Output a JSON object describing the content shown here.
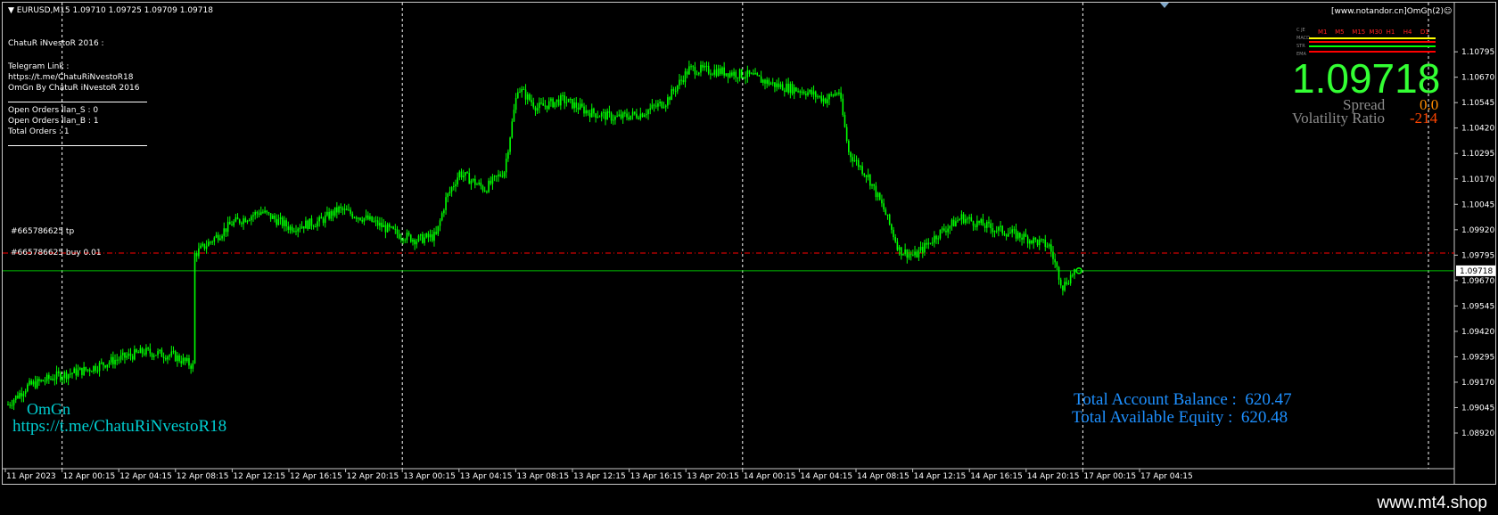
{
  "header": {
    "symbol_line": "EURUSD,M15  1.09710 1.09725 1.09709 1.09718",
    "site_label": "[www.notandor.cn]OmGn",
    "site_suffix": "(2)☺"
  },
  "info_panel": {
    "title": "ChatuR iNvestoR 2016 :",
    "telegram_label": "Telegram Link  :",
    "telegram_url": " https://t.me/ChatuRiNvestoR18",
    "byline": "OmGn By ChatuR iNvestoR 2016",
    "rows": [
      {
        "label": "Open Orders Ilan_S  :",
        "value": "0"
      },
      {
        "label": "Open Orders Ilan_B  :",
        "value": "1"
      },
      {
        "label": "Total Orders         :",
        "value": "1"
      }
    ]
  },
  "price_panel": {
    "big_price": "1.09718",
    "spread_label": "Spread",
    "spread_value": "0.0",
    "vol_label": "Volatility Ratio",
    "vol_value": "-214",
    "tf_labels": [
      "M1",
      "M5",
      "M15",
      "M30",
      "H1",
      "H4",
      "D1"
    ],
    "ind_labels": [
      "C JE",
      "MACD",
      "STR",
      "EMA"
    ]
  },
  "account": {
    "balance_label": "Total Account Balance  :",
    "balance_value": "620.47",
    "equity_label": "Total Available Equity   :",
    "equity_value": "620.48"
  },
  "brand": {
    "name": "OmGn",
    "url": "https://t.me/ChatuRiNvestoR18"
  },
  "footer": {
    "text": "www.mt4.shop"
  },
  "order_lines": {
    "tp_label": "#665786625 tp",
    "buy_label": "#665786625 buy 0.01",
    "tp_price": 1.09805,
    "buy_price": 1.09718
  },
  "colors": {
    "bull": "#00ff00",
    "bear": "#00ff00",
    "tp_line": "#ff0000",
    "buy_line": "#00c000",
    "grid": "#ffffff",
    "big_price": "#33ff33",
    "spread_value": "#ff8c00",
    "vol_value": "#ff4500",
    "account_text": "#1e90ff",
    "brand_text": "#00ced1"
  },
  "chart_data": {
    "type": "candlestick",
    "symbol": "EURUSD",
    "timeframe": "M15",
    "ylim": [
      1.0892,
      1.10835
    ],
    "y_ticks": [
      1.10795,
      1.1067,
      1.10545,
      1.1042,
      1.10295,
      1.1017,
      1.10045,
      1.0992,
      1.09795,
      1.0967,
      1.09545,
      1.0942,
      1.09295,
      1.0917,
      1.09045,
      1.0892
    ],
    "current_price": 1.09718,
    "x_ticks": [
      "11 Apr 2023",
      "12 Apr 00:15",
      "12 Apr 04:15",
      "12 Apr 08:15",
      "12 Apr 12:15",
      "12 Apr 16:15",
      "12 Apr 20:15",
      "13 Apr 00:15",
      "13 Apr 04:15",
      "13 Apr 08:15",
      "13 Apr 12:15",
      "13 Apr 16:15",
      "13 Apr 20:15",
      "14 Apr 00:15",
      "14 Apr 04:15",
      "14 Apr 08:15",
      "14 Apr 12:15",
      "14 Apr 16:15",
      "14 Apr 20:15",
      "17 Apr 00:15",
      "17 Apr 04:15"
    ],
    "day_separators": [
      "12 Apr 00:15",
      "13 Apr 00:15",
      "14 Apr 00:15",
      "17 Apr 00:15"
    ],
    "key_prices": [
      [
        0,
        1.0906
      ],
      [
        10,
        1.0915
      ],
      [
        25,
        1.092
      ],
      [
        40,
        1.0923
      ],
      [
        55,
        1.0928
      ],
      [
        70,
        1.0932
      ],
      [
        85,
        1.093
      ],
      [
        95,
        1.0925
      ],
      [
        96,
        1.098
      ],
      [
        105,
        1.0987
      ],
      [
        115,
        1.0995
      ],
      [
        130,
        1.1001
      ],
      [
        145,
        1.0993
      ],
      [
        160,
        1.0996
      ],
      [
        170,
        1.1002
      ],
      [
        185,
        1.0997
      ],
      [
        200,
        1.099
      ],
      [
        210,
        1.0987
      ],
      [
        220,
        1.0989
      ],
      [
        225,
        1.1007
      ],
      [
        232,
        1.102
      ],
      [
        245,
        1.1012
      ],
      [
        255,
        1.1021
      ],
      [
        262,
        1.1062
      ],
      [
        272,
        1.1052
      ],
      [
        285,
        1.1056
      ],
      [
        298,
        1.105
      ],
      [
        312,
        1.1047
      ],
      [
        325,
        1.1049
      ],
      [
        338,
        1.1055
      ],
      [
        350,
        1.1071
      ],
      [
        365,
        1.107
      ],
      [
        380,
        1.1068
      ],
      [
        395,
        1.1063
      ],
      [
        410,
        1.106
      ],
      [
        420,
        1.1056
      ],
      [
        427,
        1.106
      ],
      [
        432,
        1.103
      ],
      [
        442,
        1.1018
      ],
      [
        450,
        1.1002
      ],
      [
        458,
        1.0982
      ],
      [
        466,
        1.0979
      ],
      [
        478,
        1.099
      ],
      [
        490,
        1.0998
      ],
      [
        505,
        1.0993
      ],
      [
        520,
        1.0989
      ],
      [
        535,
        1.0984
      ],
      [
        542,
        1.0964
      ],
      [
        548,
        1.09718
      ]
    ]
  }
}
